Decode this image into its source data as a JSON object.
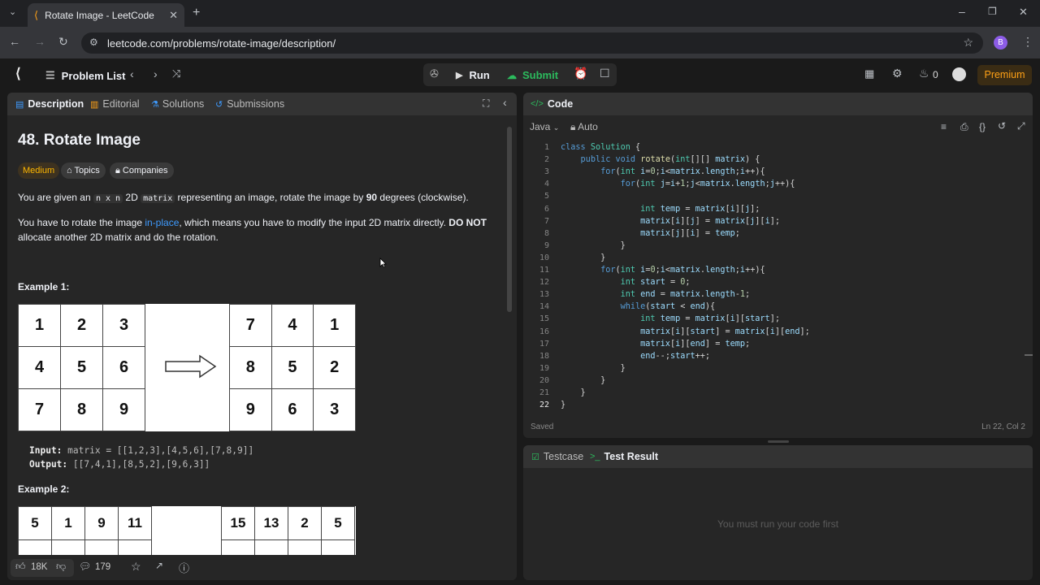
{
  "browser": {
    "tab_title": "Rotate Image - LeetCode",
    "url": "leetcode.com/problems/rotate-image/description/",
    "profile_initial": "B"
  },
  "header": {
    "problem_list": "Problem List",
    "run": "Run",
    "submit": "Submit",
    "streak": "0",
    "premium": "Premium"
  },
  "left_tabs": [
    "Description",
    "Editorial",
    "Solutions",
    "Submissions"
  ],
  "problem": {
    "title": "48. Rotate Image",
    "difficulty": "Medium",
    "topics": "Topics",
    "companies": "Companies",
    "p1_a": "You are given an ",
    "p1_code1": "n x n",
    "p1_b": " 2D ",
    "p1_code2": "matrix",
    "p1_c": " representing an image, rotate the image by ",
    "p1_bold": "90",
    "p1_d": " degrees (clockwise).",
    "p2_a": "You have to rotate the image ",
    "p2_link": "in-place",
    "p2_b": ", which means you have to modify the input 2D matrix directly. ",
    "p2_bold": "DO NOT",
    "p2_c": "allocate another 2D matrix and do the rotation.",
    "ex1_title": "Example 1:",
    "ex1_in_grid": [
      [
        "1",
        "2",
        "3"
      ],
      [
        "4",
        "5",
        "6"
      ],
      [
        "7",
        "8",
        "9"
      ]
    ],
    "ex1_out_grid": [
      [
        "7",
        "4",
        "1"
      ],
      [
        "8",
        "5",
        "2"
      ],
      [
        "9",
        "6",
        "3"
      ]
    ],
    "ex1_input_label": "Input:",
    "ex1_input": "matrix = [[1,2,3],[4,5,6],[7,8,9]]",
    "ex1_output_label": "Output:",
    "ex1_output": "[[7,4,1],[8,5,2],[9,6,3]]",
    "ex2_title": "Example 2:",
    "ex2_in_row1": [
      "5",
      "1",
      "9",
      "11"
    ],
    "ex2_out_row1": [
      "15",
      "13",
      "2",
      "5"
    ]
  },
  "footer": {
    "likes": "18K",
    "comments": "179"
  },
  "code_panel": {
    "title": "Code",
    "language": "Java",
    "mode": "Auto",
    "status": "Saved",
    "cursor": "Ln 22, Col 2",
    "lines": [
      "class Solution {",
      "    public void rotate(int[][] matrix) {",
      "        for(int i=0;i<matrix.length;i++){",
      "            for(int j=i+1;j<matrix.length;j++){",
      "",
      "                int temp = matrix[i][j];",
      "                matrix[i][j] = matrix[j][i];",
      "                matrix[j][i] = temp;",
      "            }",
      "        }",
      "        for(int i=0;i<matrix.length;i++){",
      "            int start = 0;",
      "            int end = matrix.length-1;",
      "            while(start < end){",
      "                int temp = matrix[i][start];",
      "                matrix[i][start] = matrix[i][end];",
      "                matrix[i][end] = temp;",
      "                end--;start++;",
      "            }",
      "        }",
      "    }",
      "}"
    ]
  },
  "result_panel": {
    "testcase": "Testcase",
    "test_result": "Test Result",
    "empty_msg": "You must run your code first"
  },
  "colors": {
    "accent": "#ffa116",
    "green": "#2cbb5d",
    "link": "#3e9bff",
    "medium": "#ffb800"
  }
}
